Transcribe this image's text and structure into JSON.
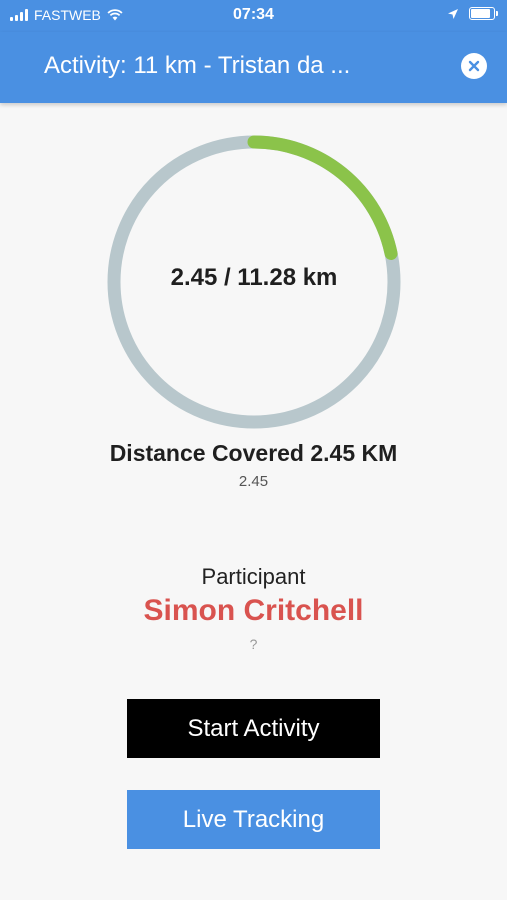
{
  "status_bar": {
    "carrier": "FASTWEB",
    "time": "07:34",
    "battery_level": 0.95
  },
  "header": {
    "title": "Activity: 11 km - Tristan da ...",
    "close_icon": "close-circle-icon"
  },
  "progress": {
    "covered_km": 2.45,
    "total_km": 11.28,
    "ring_label": "2.45 / 11.28 km",
    "track_color": "#b8c7cc",
    "fill_color": "#8bc34a"
  },
  "distance": {
    "title": "Distance Covered 2.45 KM",
    "subtitle": "2.45"
  },
  "participant": {
    "label": "Participant",
    "name": "Simon Critchell",
    "extra": "?"
  },
  "buttons": {
    "start_label": "Start Activity",
    "live_label": "Live Tracking"
  },
  "colors": {
    "primary": "#4a90e2",
    "accent_name": "#d9534f",
    "start_button": "#000000"
  }
}
